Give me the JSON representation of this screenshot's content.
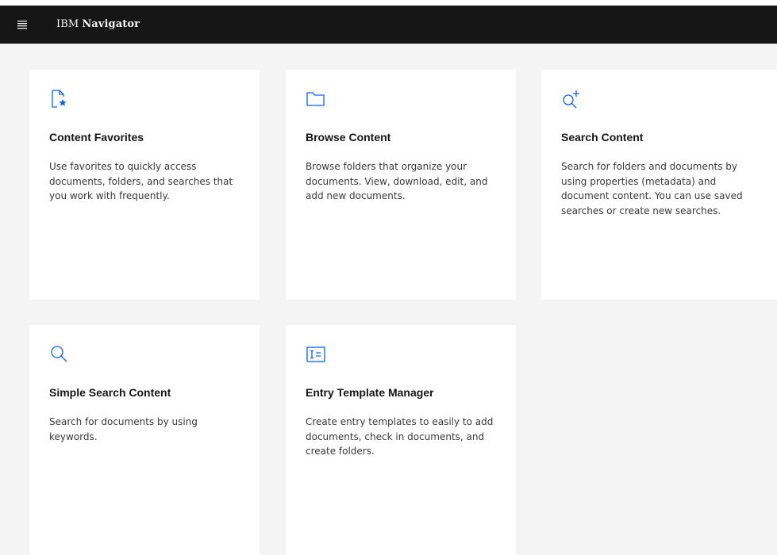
{
  "header": {
    "brand_prefix": "IBM",
    "brand_name": "Navigator",
    "menu_icon": "hamburger-menu-icon"
  },
  "colors": {
    "header_bg": "#161616",
    "page_bg": "#f4f4f4",
    "tile_bg": "#ffffff",
    "icon_accent": "#0f62fe"
  },
  "tiles": [
    {
      "icon": "document-star-icon",
      "title": "Content Favorites",
      "description": "Use favorites to quickly access documents, folders, and searches that you work with frequently."
    },
    {
      "icon": "folder-icon",
      "title": "Browse Content",
      "description": "Browse folders that organize your documents. View, download, edit, and add new documents."
    },
    {
      "icon": "search-add-icon",
      "title": "Search Content",
      "description": "Search for folders and documents by using properties (metadata) and document content. You can use saved searches or create new searches."
    },
    {
      "icon": "search-icon",
      "title": "Simple Search Content",
      "description": "Search for documents by using keywords."
    },
    {
      "icon": "template-icon",
      "title": "Entry Template Manager",
      "description": "Create entry templates to easily to add documents, check in documents, and create folders."
    }
  ]
}
